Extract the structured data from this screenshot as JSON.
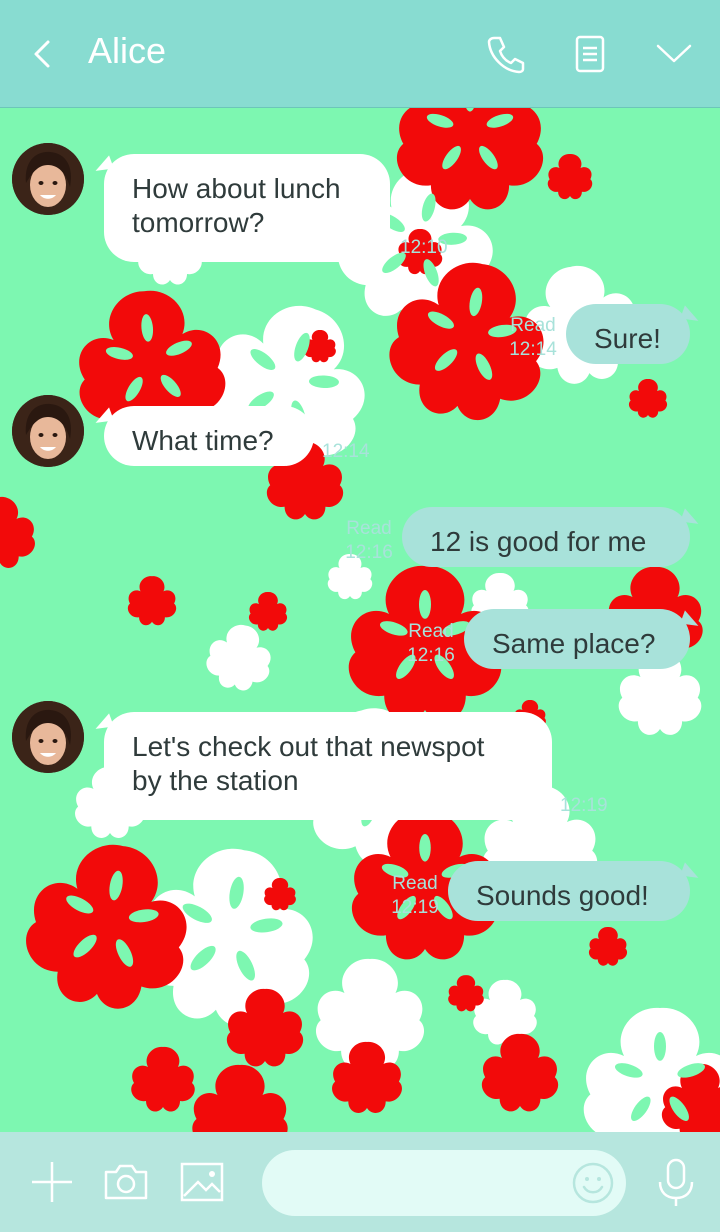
{
  "header": {
    "title": "Alice",
    "icons": [
      "back-icon",
      "phone-icon",
      "notes-icon",
      "chevron-down-icon"
    ]
  },
  "messages": [
    {
      "side": "in",
      "lines": [
        "How about lunch",
        "tomorrow?"
      ],
      "time": "12:10"
    },
    {
      "side": "out",
      "lines": [
        "Sure!"
      ],
      "read": "Read",
      "time": "12:14"
    },
    {
      "side": "in",
      "lines": [
        "What time?"
      ],
      "time": "12:14"
    },
    {
      "side": "out",
      "lines": [
        "12 is good for me"
      ],
      "read": "Read",
      "time": "12:16"
    },
    {
      "side": "out",
      "lines": [
        "Same place?"
      ],
      "read": "Read",
      "time": "12:16"
    },
    {
      "side": "in",
      "lines": [
        "Let's check out that newspot",
        "by the station"
      ],
      "time": "12:19"
    },
    {
      "side": "out",
      "lines": [
        "Sounds good!"
      ],
      "read": "Read",
      "time": "12:19"
    }
  ],
  "input": {
    "placeholder": ""
  },
  "bottom_icons": [
    "plus-icon",
    "camera-icon",
    "image-icon",
    "emoji-icon",
    "microphone-icon"
  ],
  "colors": {
    "header": "#88dcd1",
    "background": "#7df7b1",
    "incoming_bubble": "#ffffff",
    "outgoing_bubble": "#a8e2da",
    "flower_red": "#f20a0a",
    "flower_white": "#ffffff",
    "bottom_bar": "#b6e6de"
  }
}
